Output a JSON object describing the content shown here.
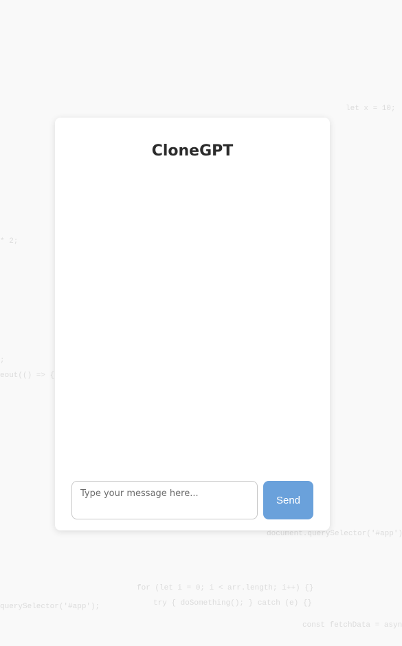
{
  "app": {
    "title": "CloneGPT"
  },
  "composer": {
    "placeholder": "Type your message here...",
    "value": "",
    "send_label": "Send"
  },
  "background_code": [
    "let x = 10;",
    "* 2;",
    ";",
    "eout(() => {",
    "document.querySelector('#app')",
    "for (let i = 0; i < arr.length; i++) {}",
    "querySelector('#app');",
    "try { doSomething(); } catch (e) {}",
    "const fetchData = asyn"
  ],
  "colors": {
    "page_bg": "#f9f9f9",
    "card_bg": "#ffffff",
    "title_text": "#2b2b2b",
    "send_button": "#6aa1db",
    "send_text": "#ffffff",
    "input_border": "#c8c8c8",
    "bg_code_text": "#dcdcdc"
  }
}
